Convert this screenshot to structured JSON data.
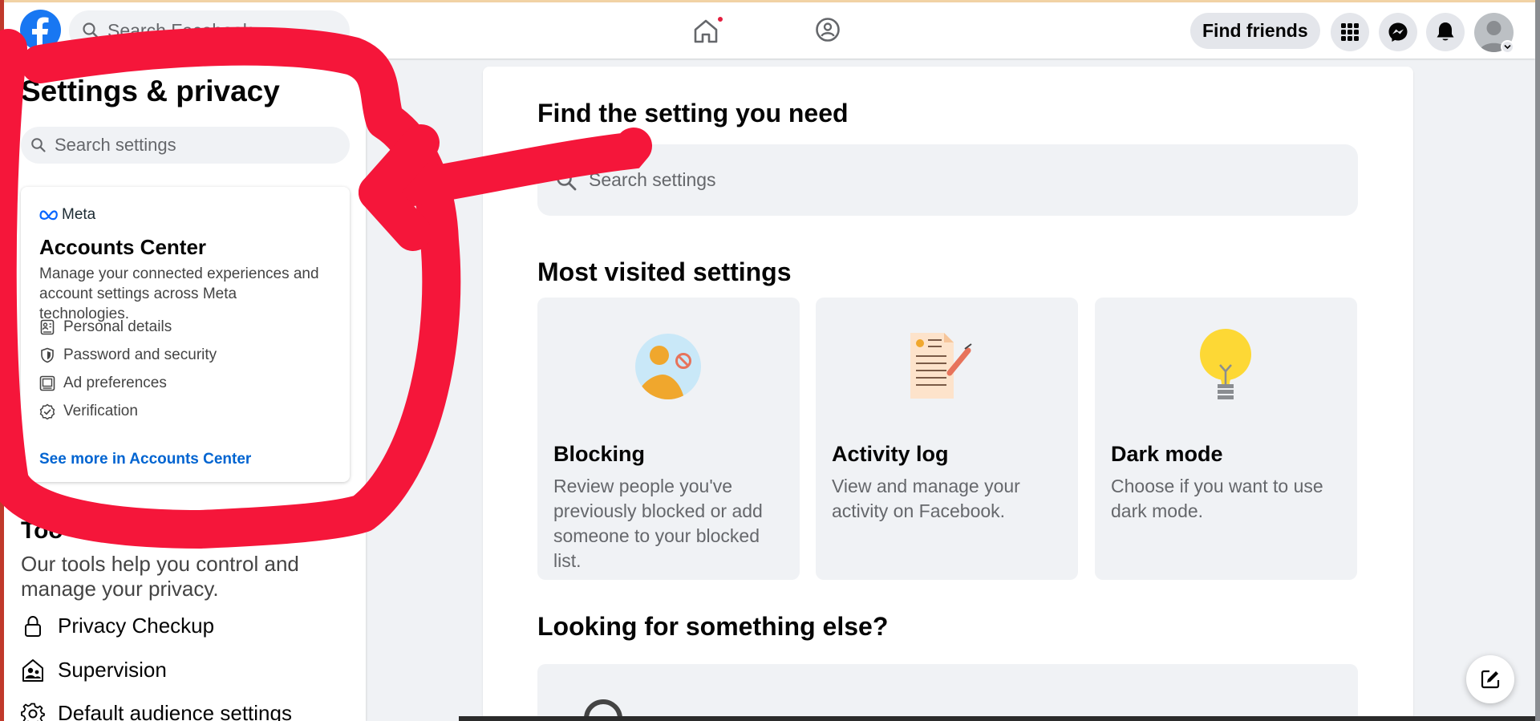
{
  "topbar": {
    "search_placeholder": "Search Facebook",
    "find_friends_label": "Find friends",
    "accent": "#1877f2",
    "notification_dot_color": "#e41e3f"
  },
  "sidebar": {
    "title": "Settings & privacy",
    "search_placeholder": "Search settings",
    "accounts_center": {
      "brand": "Meta",
      "title": "Accounts Center",
      "description": "Manage your connected experiences and account settings across Meta technologies.",
      "items": [
        {
          "label": "Personal details",
          "icon": "id-card-icon"
        },
        {
          "label": "Password and security",
          "icon": "shield-icon"
        },
        {
          "label": "Ad preferences",
          "icon": "monitor-icon"
        },
        {
          "label": "Verification",
          "icon": "verified-badge-icon"
        }
      ],
      "link": "See more in Accounts Center"
    },
    "tools": {
      "heading": "Too",
      "description": "Our tools help you control and manage your privacy.",
      "items": [
        {
          "label": "Privacy Checkup",
          "icon": "lock-icon"
        },
        {
          "label": "Supervision",
          "icon": "supervision-icon"
        },
        {
          "label": "Default audience settings",
          "icon": "gear-icon"
        }
      ]
    }
  },
  "main": {
    "find_heading": "Find the setting you need",
    "search_placeholder": "Search settings",
    "most_visited_heading": "Most visited settings",
    "tiles": [
      {
        "title": "Blocking",
        "description": "Review people you've previously blocked or add someone to your blocked list.",
        "icon": "blocking-illustration"
      },
      {
        "title": "Activity log",
        "description": "View and manage your activity on Facebook.",
        "icon": "activity-log-illustration"
      },
      {
        "title": "Dark mode",
        "description": "Choose if you want to use dark mode.",
        "icon": "lightbulb-illustration"
      }
    ],
    "looking_heading": "Looking for something else?"
  },
  "annotation": {
    "color": "#f5163a"
  }
}
